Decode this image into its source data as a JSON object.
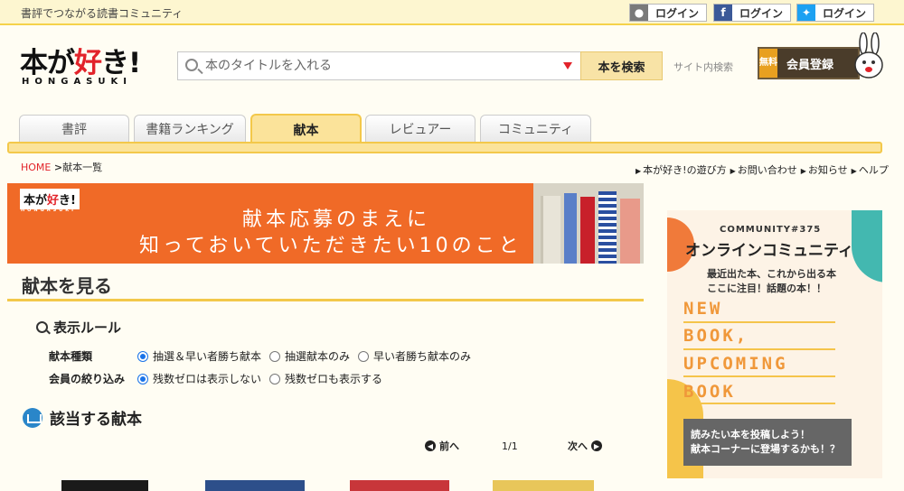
{
  "header": {
    "tagline": "書評でつながる読書コミュニティ",
    "logins": [
      {
        "icon": "user-icon",
        "label": "ログイン"
      },
      {
        "icon": "facebook-icon",
        "label": "ログイン"
      },
      {
        "icon": "twitter-icon",
        "label": "ログイン"
      }
    ],
    "logo_main_pre": "本が",
    "logo_main_red": "好",
    "logo_main_post": "き!",
    "logo_sub": "HONGASUKI"
  },
  "search": {
    "placeholder": "本のタイトルを入れる",
    "button_label": "本を検索",
    "site_search_label": "サイト内検索"
  },
  "register": {
    "free_label": "無料",
    "label": "会員登録"
  },
  "nav": {
    "tabs": [
      {
        "label": "書評",
        "active": false
      },
      {
        "label": "書籍ランキング",
        "active": false
      },
      {
        "label": "献本",
        "active": true
      },
      {
        "label": "レビュアー",
        "active": false
      },
      {
        "label": "コミュニティ",
        "active": false
      }
    ]
  },
  "breadcrumb": {
    "home": "HOME",
    "current": "献本一覧"
  },
  "util_links": [
    "本が好き!の遊び方",
    "お問い合わせ",
    "お知らせ",
    "ヘルプ"
  ],
  "banner": {
    "logo_text_pre": "本が",
    "logo_text_red": "好",
    "logo_text_post": "き!",
    "logo_sub": "HONGASUKI",
    "line1": "献本応募のまえに",
    "line2": "知っておいていただきたい10のこと"
  },
  "main": {
    "section_title": "献本を見る",
    "rules_heading": "表示ルール",
    "type_row": {
      "label": "献本種類",
      "options": [
        "抽選＆早い者勝ち献本",
        "抽選献本のみ",
        "早い者勝ち献本のみ"
      ],
      "selected": "抽選＆早い者勝ち献本"
    },
    "filter_row": {
      "label": "会員の絞り込み",
      "options": [
        "残数ゼロは表示しない",
        "残数ゼロも表示する"
      ],
      "selected": "残数ゼロは表示しない"
    },
    "found_heading": "該当する献本",
    "pager": {
      "prev": "前へ",
      "count": "1/1",
      "next": "次へ"
    }
  },
  "side_ad": {
    "community": "COMMUNITY#375",
    "title": "オンラインコミュニティ",
    "desc1": "最近出た本、これから出る本",
    "desc2": "ここに注目！話題の本！！",
    "big_lines": [
      "NEW",
      "BOOK,",
      "UPCOMING",
      "BOOK"
    ],
    "cta_line1": "読みたい本を投稿しよう！",
    "cta_line2": "献本コーナーに登場するかも！？"
  },
  "colors": {
    "accent_yellow": "#fbe39a",
    "brand_red": "#e2232a",
    "banner_orange": "#f06a27"
  }
}
